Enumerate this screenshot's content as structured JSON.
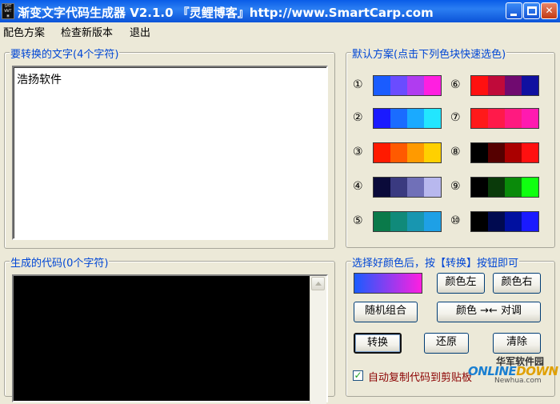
{
  "window": {
    "title": "渐变文字代码生成器 V2.1.0 『灵鲤博客』http://www.SmartCarp.com"
  },
  "menu": [
    "配色方案",
    "检查新版本",
    "退出"
  ],
  "input_group": {
    "label": "要转换的文字(4个字符)",
    "value": "浩扬软件"
  },
  "output_group": {
    "label": "生成的代码(0个字符)"
  },
  "schemes_group": {
    "label": "默认方案(点击下列色块快速选色)",
    "schemes": [
      {
        "num": "①",
        "colors": [
          "#1a5cff",
          "#6a4cff",
          "#b03cf0",
          "#ff1fe0"
        ]
      },
      {
        "num": "②",
        "colors": [
          "#1a1aff",
          "#1a6cff",
          "#1aaaff",
          "#22e6ff"
        ]
      },
      {
        "num": "③",
        "colors": [
          "#ff1a00",
          "#ff5a00",
          "#ff9a00",
          "#ffd000"
        ]
      },
      {
        "num": "④",
        "colors": [
          "#0a0a3a",
          "#3a3a80",
          "#7070b8",
          "#b8b8ee"
        ]
      },
      {
        "num": "⑤",
        "colors": [
          "#0a7a4a",
          "#108a7a",
          "#1896b0",
          "#1ea0e6"
        ]
      },
      {
        "num": "⑥",
        "colors": [
          "#ff1010",
          "#c00a3a",
          "#700a70",
          "#1010a0"
        ]
      },
      {
        "num": "⑦",
        "colors": [
          "#ff1a1a",
          "#ff1a4a",
          "#ff1a80",
          "#ff1ab0"
        ]
      },
      {
        "num": "⑧",
        "colors": [
          "#000000",
          "#550000",
          "#aa0000",
          "#ff1010"
        ]
      },
      {
        "num": "⑨",
        "colors": [
          "#000000",
          "#0a3a0a",
          "#0a8a0a",
          "#10ff10"
        ]
      },
      {
        "num": "⑩",
        "colors": [
          "#000000",
          "#000a50",
          "#0010a0",
          "#1a1aff"
        ]
      }
    ]
  },
  "controls_group": {
    "label": "选择好颜色后，按【转换】按钮即可",
    "preview_colors": [
      "#1a5cff",
      "#ff1fe0"
    ],
    "buttons": {
      "color_left": "颜色左",
      "color_right": "颜色右",
      "random": "随机组合",
      "swap": "颜色 →← 对调",
      "convert": "转换",
      "restore": "还原",
      "clear": "清除"
    },
    "auto_copy_label": "自动复制代码到剪贴板",
    "auto_copy_checked": true
  },
  "watermark": {
    "site_cn": "华军软件园",
    "logo_a": "ONLINE",
    "logo_b": "DOWN",
    "url": "Newhua.com"
  }
}
